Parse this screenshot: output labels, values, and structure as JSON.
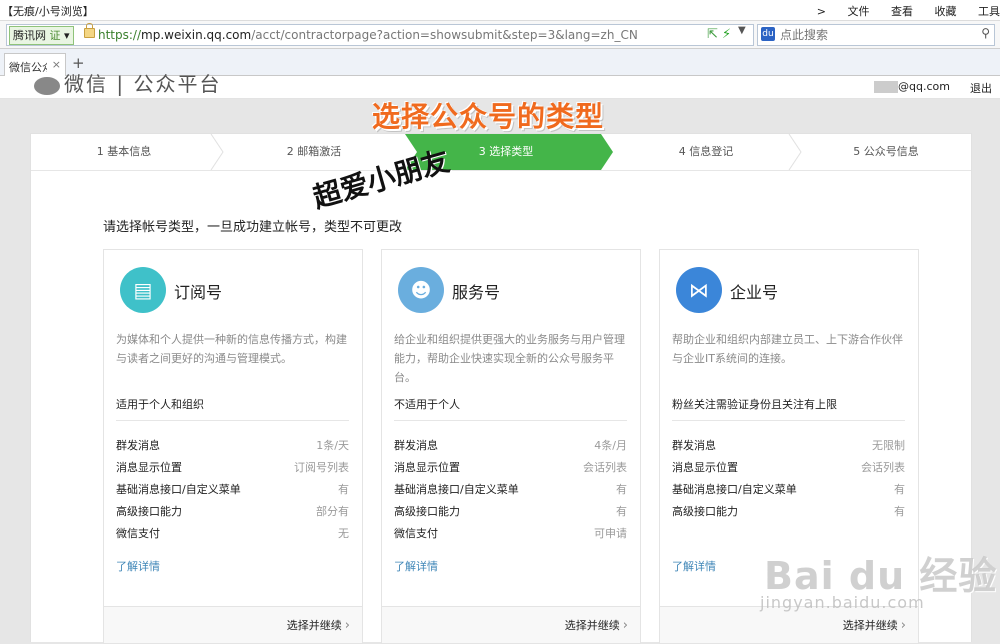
{
  "browser": {
    "window_title": "【无痕/小号浏览】",
    "menus": [
      ">",
      "文件",
      "查看",
      "收藏",
      "工具"
    ],
    "site_tag": "腾讯网",
    "cert_label": "证",
    "url_scheme": "https://",
    "url_host": "mp.weixin.qq.com",
    "url_path": "/acct/contractorpage?action=showsubmit&step=3&lang=zh_CN",
    "search_placeholder": "点此搜索",
    "tab_title": "微信公众平台",
    "new_tab": "+",
    "tab_close": "×"
  },
  "header": {
    "logo_text": "微信 | 公众平台",
    "account": "@qq.com",
    "logout": "退出"
  },
  "overlay": {
    "headline": "选择公众号的类型",
    "handwritten": "超爱小朋友"
  },
  "steps": [
    {
      "label": "1 基本信息"
    },
    {
      "label": "2 邮箱激活"
    },
    {
      "label": "3 选择类型"
    },
    {
      "label": "4 信息登记"
    },
    {
      "label": "5 公众号信息"
    }
  ],
  "intro": "请选择帐号类型，一旦成功建立帐号，类型不可更改",
  "cards": [
    {
      "title": "订阅号",
      "desc": "为媒体和个人提供一种新的信息传播方式，构建与读者之间更好的沟通与管理模式。",
      "who": "适用于个人和组织",
      "rows": [
        {
          "k": "群发消息",
          "v": "1条/天"
        },
        {
          "k": "消息显示位置",
          "v": "订阅号列表"
        },
        {
          "k": "基础消息接口/自定义菜单",
          "v": "有"
        },
        {
          "k": "高级接口能力",
          "v": "部分有"
        },
        {
          "k": "微信支付",
          "v": "无"
        }
      ],
      "more": "了解详情",
      "button": "选择并继续",
      "color": "#3fc1c9"
    },
    {
      "title": "服务号",
      "desc": "给企业和组织提供更强大的业务服务与用户管理能力，帮助企业快速实现全新的公众号服务平台。",
      "who": "不适用于个人",
      "rows": [
        {
          "k": "群发消息",
          "v": "4条/月"
        },
        {
          "k": "消息显示位置",
          "v": "会话列表"
        },
        {
          "k": "基础消息接口/自定义菜单",
          "v": "有"
        },
        {
          "k": "高级接口能力",
          "v": "有"
        },
        {
          "k": "微信支付",
          "v": "可申请"
        }
      ],
      "more": "了解详情",
      "button": "选择并继续",
      "color": "#6aaede"
    },
    {
      "title": "企业号",
      "desc": "帮助企业和组织内部建立员工、上下游合作伙伴与企业IT系统间的连接。",
      "who": "粉丝关注需验证身份且关注有上限",
      "rows": [
        {
          "k": "群发消息",
          "v": "无限制"
        },
        {
          "k": "消息显示位置",
          "v": "会话列表"
        },
        {
          "k": "基础消息接口/自定义菜单",
          "v": "有"
        },
        {
          "k": "高级接口能力",
          "v": "有"
        }
      ],
      "more": "了解详情",
      "button": "选择并继续",
      "color": "#3b86d9"
    }
  ],
  "watermark": {
    "brand": "Bai du 经验",
    "site": "jingyan.baidu.com"
  }
}
